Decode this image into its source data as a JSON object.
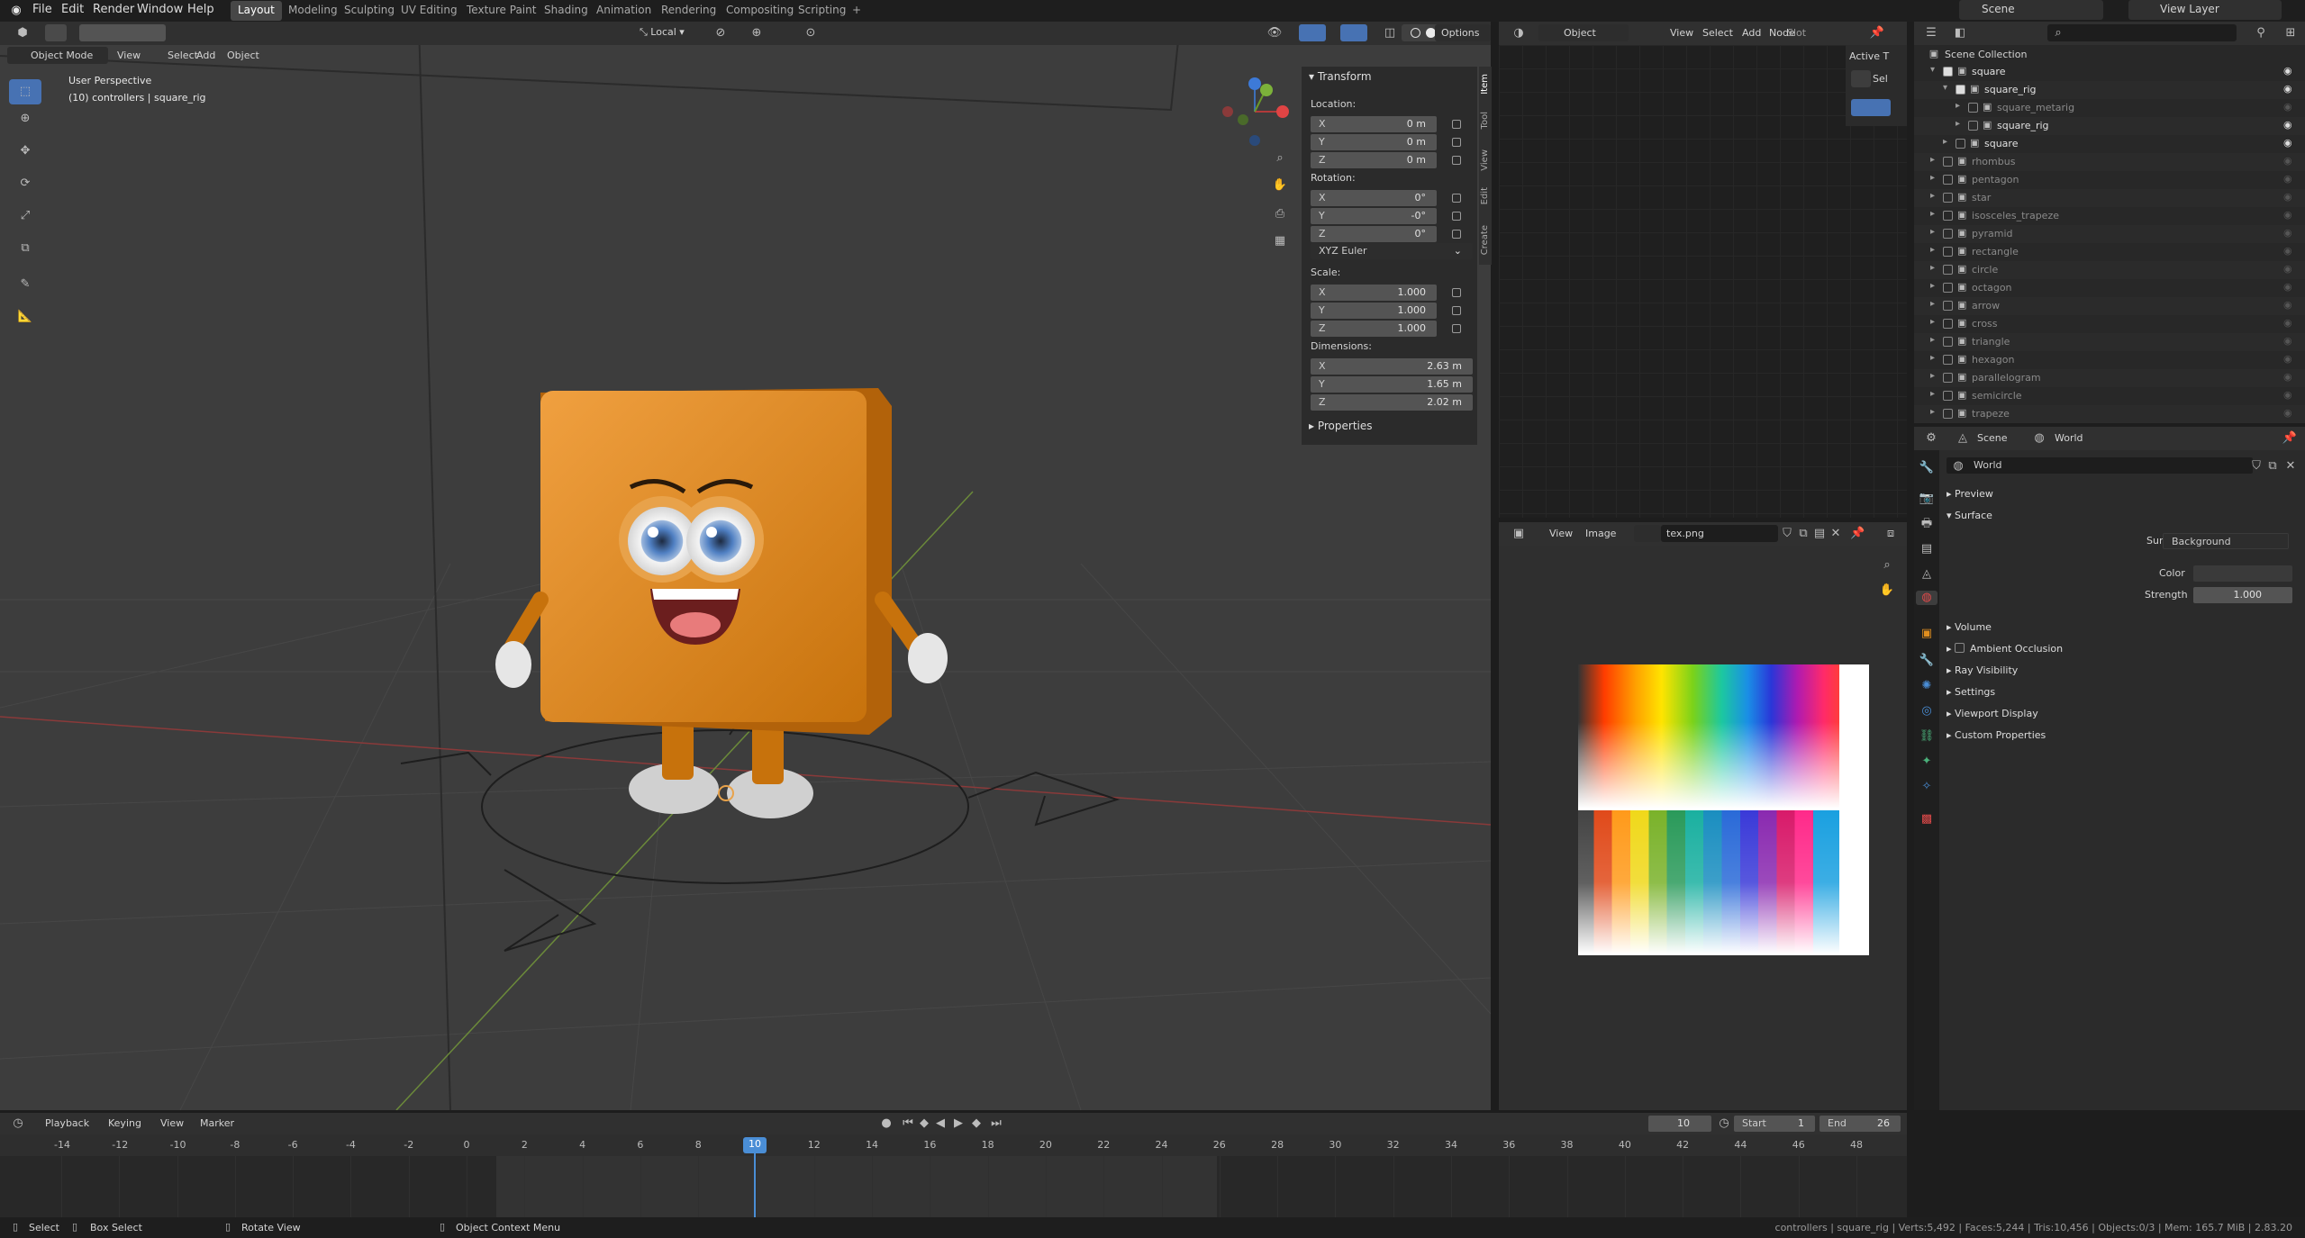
{
  "app": {
    "menus": [
      "File",
      "Edit",
      "Render",
      "Window",
      "Help"
    ],
    "workspaces": [
      "Layout",
      "Modeling",
      "Sculpting",
      "UV Editing",
      "Texture Paint",
      "Shading",
      "Animation",
      "Rendering",
      "Compositing",
      "Scripting"
    ],
    "active_workspace": "Layout",
    "add_tab_icon": "+",
    "scene": "Scene",
    "view_layer": "View Layer"
  },
  "viewport": {
    "mode": "Object Mode",
    "menus": [
      "View",
      "Select",
      "Add",
      "Object"
    ],
    "transform_orientation": "Local",
    "options": "Options",
    "overlay_title": "User Perspective",
    "overlay_sub": "(10) controllers | square_rig",
    "side_tabs": [
      "Item",
      "Tool",
      "View",
      "Edit",
      "Create"
    ]
  },
  "npanel": {
    "transform_title": "Transform",
    "location_label": "Location:",
    "location": [
      {
        "axis": "X",
        "value": "0 m"
      },
      {
        "axis": "Y",
        "value": "0 m"
      },
      {
        "axis": "Z",
        "value": "0 m"
      }
    ],
    "rotation_label": "Rotation:",
    "rotation": [
      {
        "axis": "X",
        "value": "0°"
      },
      {
        "axis": "Y",
        "value": "-0°"
      },
      {
        "axis": "Z",
        "value": "0°"
      }
    ],
    "rotation_mode": "XYZ Euler",
    "scale_label": "Scale:",
    "scale": [
      {
        "axis": "X",
        "value": "1.000"
      },
      {
        "axis": "Y",
        "value": "1.000"
      },
      {
        "axis": "Z",
        "value": "1.000"
      }
    ],
    "dimensions_label": "Dimensions:",
    "dimensions": [
      {
        "axis": "X",
        "value": "2.63 m"
      },
      {
        "axis": "Y",
        "value": "1.65 m"
      },
      {
        "axis": "Z",
        "value": "2.02 m"
      }
    ],
    "properties_title": "Properties"
  },
  "node_editor": {
    "type": "Object",
    "menus": [
      "View",
      "Select",
      "Add",
      "Node"
    ],
    "slot": "Slot",
    "active_tool": "Active T",
    "select_short": "Sel"
  },
  "image_editor": {
    "menus": [
      "View",
      "Image"
    ],
    "image_name": "tex.png"
  },
  "outliner": {
    "root": "Scene Collection",
    "items": [
      {
        "name": "square",
        "level": 1,
        "expanded": true,
        "checked": true,
        "visible": true
      },
      {
        "name": "square_rig",
        "level": 2,
        "expanded": true,
        "checked": true,
        "visible": true
      },
      {
        "name": "square_metarig",
        "level": 3,
        "expanded": false,
        "checked": false,
        "visible": false
      },
      {
        "name": "square_rig",
        "level": 3,
        "expanded": false,
        "checked": false,
        "visible": true
      },
      {
        "name": "square",
        "level": 2,
        "expanded": false,
        "checked": false,
        "visible": true
      },
      {
        "name": "rhombus",
        "level": 1,
        "expanded": false,
        "checked": false,
        "visible": false
      },
      {
        "name": "pentagon",
        "level": 1,
        "expanded": false,
        "checked": false,
        "visible": false
      },
      {
        "name": "star",
        "level": 1,
        "expanded": false,
        "checked": false,
        "visible": false
      },
      {
        "name": "isosceles_trapeze",
        "level": 1,
        "expanded": false,
        "checked": false,
        "visible": false
      },
      {
        "name": "pyramid",
        "level": 1,
        "expanded": false,
        "checked": false,
        "visible": false
      },
      {
        "name": "rectangle",
        "level": 1,
        "expanded": false,
        "checked": false,
        "visible": false
      },
      {
        "name": "circle",
        "level": 1,
        "expanded": false,
        "checked": false,
        "visible": false
      },
      {
        "name": "octagon",
        "level": 1,
        "expanded": false,
        "checked": false,
        "visible": false
      },
      {
        "name": "arrow",
        "level": 1,
        "expanded": false,
        "checked": false,
        "visible": false
      },
      {
        "name": "cross",
        "level": 1,
        "expanded": false,
        "checked": false,
        "visible": false
      },
      {
        "name": "triangle",
        "level": 1,
        "expanded": false,
        "checked": false,
        "visible": false
      },
      {
        "name": "hexagon",
        "level": 1,
        "expanded": false,
        "checked": false,
        "visible": false
      },
      {
        "name": "parallelogram",
        "level": 1,
        "expanded": false,
        "checked": false,
        "visible": false
      },
      {
        "name": "semicircle",
        "level": 1,
        "expanded": false,
        "checked": false,
        "visible": false
      },
      {
        "name": "trapeze",
        "level": 1,
        "expanded": false,
        "checked": false,
        "visible": false
      }
    ]
  },
  "properties": {
    "breadcrumb_scene": "Scene",
    "breadcrumb_world": "World",
    "world_name": "World",
    "preview": "Preview",
    "surface": "Surface",
    "surface_label": "Surface",
    "surface_value": "Background",
    "color_label": "Color",
    "strength_label": "Strength",
    "strength_value": "1.000",
    "panels": [
      "Volume",
      "Ambient Occlusion",
      "Ray Visibility",
      "Settings",
      "Viewport Display",
      "Custom Properties"
    ]
  },
  "timeline": {
    "menus": [
      "Playback",
      "Keying",
      "View",
      "Marker"
    ],
    "current_frame": "10",
    "start_label": "Start",
    "start": "1",
    "end_label": "End",
    "end": "26",
    "ticks": [
      -14,
      -12,
      -10,
      -8,
      -6,
      -4,
      -2,
      0,
      2,
      4,
      6,
      8,
      10,
      12,
      14,
      16,
      18,
      20,
      22,
      24,
      26,
      28,
      30,
      32,
      34,
      36,
      38,
      40,
      42,
      44,
      46,
      48
    ]
  },
  "statusbar": {
    "select": "Select",
    "box_select": "Box Select",
    "rotate_view": "Rotate View",
    "context_menu": "Object Context Menu",
    "stats": "controllers | square_rig | Verts:5,492 | Faces:5,244 | Tris:10,456 | Objects:0/3 | Mem: 165.7 MiB | 2.83.20"
  },
  "colors": {
    "accent": "#4772b3",
    "orange": "#e08e1f",
    "frame_marker": "#4a8ed6"
  }
}
